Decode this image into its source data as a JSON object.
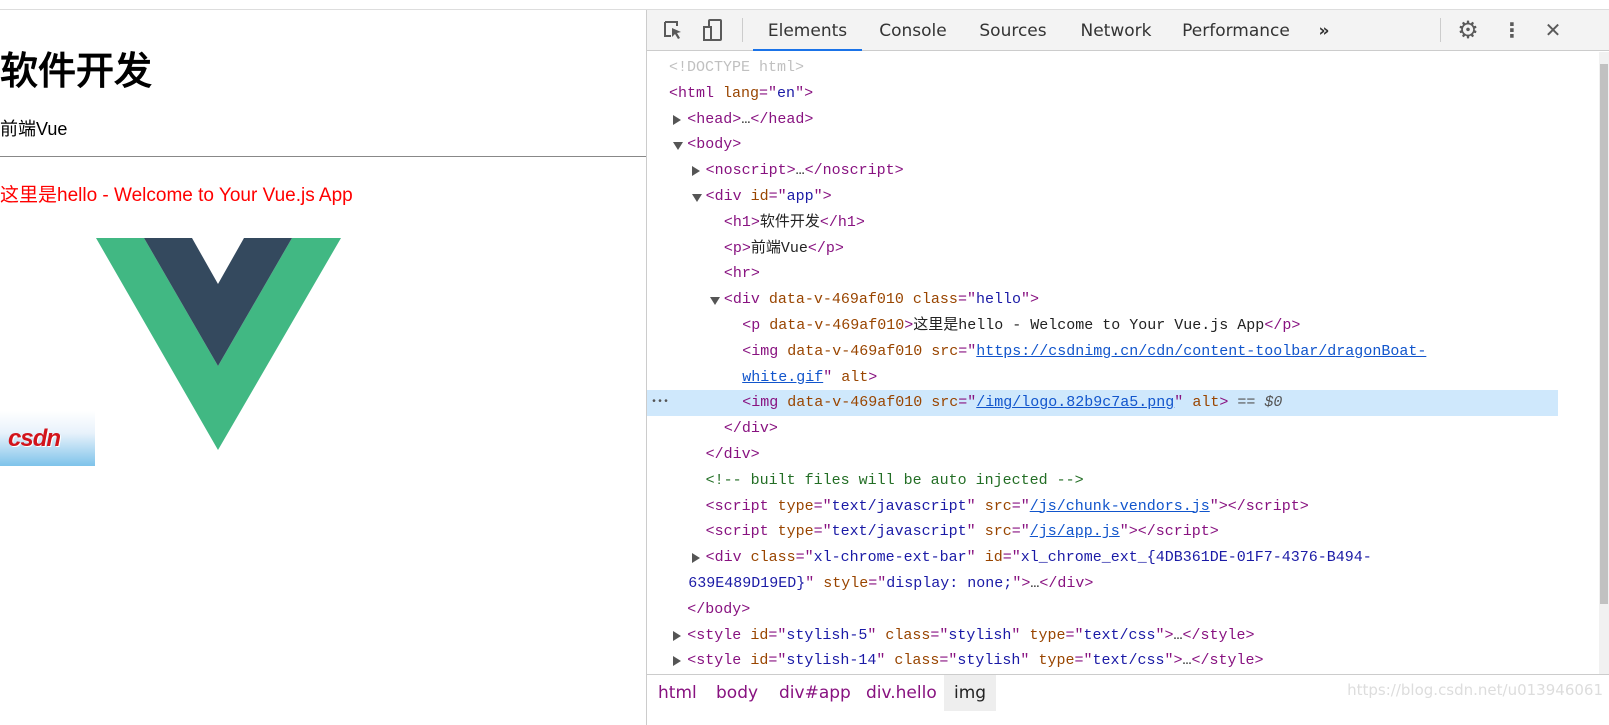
{
  "page": {
    "heading": "软件开发",
    "paragraph": "前端Vue",
    "hello_text": "这里是hello - Welcome to Your Vue.js App",
    "csdn_logo_text": "CSDN"
  },
  "devtools": {
    "tabs": [
      {
        "label": "Elements",
        "active": true
      },
      {
        "label": "Console"
      },
      {
        "label": "Sources"
      },
      {
        "label": "Network"
      },
      {
        "label": "Performance"
      }
    ],
    "more_tabs": "»",
    "settings_icon": "gear-icon",
    "menu_icon": "vertical-dots-icon",
    "close_icon": "close-icon",
    "selected_suffix": " == $0",
    "tree": [
      {
        "lvl": 0,
        "tok": [
          [
            "d",
            "<!DOCTYPE html>"
          ]
        ]
      },
      {
        "lvl": 0,
        "tok": [
          [
            "t",
            "<html "
          ],
          [
            "a",
            "lang"
          ],
          [
            "t",
            "=\""
          ],
          [
            "v",
            "en"
          ],
          [
            "t",
            "\">"
          ]
        ]
      },
      {
        "lvl": 1,
        "arrow": "r",
        "tok": [
          [
            "t",
            "<head>"
          ],
          [
            "x",
            "…"
          ],
          [
            "t",
            "</head>"
          ]
        ]
      },
      {
        "lvl": 1,
        "arrow": "d",
        "tok": [
          [
            "t",
            "<body>"
          ]
        ]
      },
      {
        "lvl": 2,
        "arrow": "r",
        "tok": [
          [
            "t",
            "<noscript>"
          ],
          [
            "x",
            "…"
          ],
          [
            "t",
            "</noscript>"
          ]
        ]
      },
      {
        "lvl": 2,
        "arrow": "d",
        "tok": [
          [
            "t",
            "<div "
          ],
          [
            "a",
            "id"
          ],
          [
            "t",
            "=\""
          ],
          [
            "v",
            "app"
          ],
          [
            "t",
            "\">"
          ]
        ]
      },
      {
        "lvl": 3,
        "tok": [
          [
            "t",
            "<h1>"
          ],
          [
            "x",
            "软件开发"
          ],
          [
            "t",
            "</h1>"
          ]
        ]
      },
      {
        "lvl": 3,
        "tok": [
          [
            "t",
            "<p>"
          ],
          [
            "x",
            "前端Vue"
          ],
          [
            "t",
            "</p>"
          ]
        ]
      },
      {
        "lvl": 3,
        "tok": [
          [
            "t",
            "<hr>"
          ]
        ]
      },
      {
        "lvl": 3,
        "arrow": "d",
        "tok": [
          [
            "t",
            "<div "
          ],
          [
            "a",
            "data-v-469af010 class"
          ],
          [
            "t",
            "=\""
          ],
          [
            "v",
            "hello"
          ],
          [
            "t",
            "\">"
          ]
        ]
      },
      {
        "lvl": 4,
        "tok": [
          [
            "t",
            "<p "
          ],
          [
            "a",
            "data-v-469af010"
          ],
          [
            "t",
            ">"
          ],
          [
            "x",
            "这里是hello - Welcome to Your Vue.js App"
          ],
          [
            "t",
            "</p>"
          ]
        ]
      },
      {
        "lvl": 4,
        "tok": [
          [
            "t",
            "<img "
          ],
          [
            "a",
            "data-v-469af010 src"
          ],
          [
            "t",
            "=\""
          ],
          [
            "l",
            "https://csdnimg.cn/cdn/content-toolbar/dragonBoat-"
          ]
        ]
      },
      {
        "lvl": 4,
        "tok": [
          [
            "l",
            "white.gif"
          ],
          [
            "t",
            "\" "
          ],
          [
            "a",
            "alt"
          ],
          [
            "t",
            ">"
          ]
        ]
      },
      {
        "lvl": 4,
        "sel": true,
        "tok": [
          [
            "t",
            "<img "
          ],
          [
            "a",
            "data-v-469af010 src"
          ],
          [
            "t",
            "=\""
          ],
          [
            "l",
            "/img/logo.82b9c7a5.png"
          ],
          [
            "t",
            "\" "
          ],
          [
            "a",
            "alt"
          ],
          [
            "t",
            ">"
          ],
          [
            "i",
            " == $0"
          ]
        ]
      },
      {
        "lvl": 3,
        "tok": [
          [
            "t",
            "</div>"
          ]
        ]
      },
      {
        "lvl": 2,
        "tok": [
          [
            "t",
            "</div>"
          ]
        ]
      },
      {
        "lvl": 2,
        "tok": [
          [
            "c",
            "<!-- built files will be auto injected -->"
          ]
        ]
      },
      {
        "lvl": 2,
        "tok": [
          [
            "t",
            "<script "
          ],
          [
            "a",
            "type"
          ],
          [
            "t",
            "=\""
          ],
          [
            "v",
            "text/javascript"
          ],
          [
            "t",
            "\" "
          ],
          [
            "a",
            "src"
          ],
          [
            "t",
            "=\""
          ],
          [
            "l",
            "/js/chunk-vendors.js"
          ],
          [
            "t",
            "\"></script>"
          ]
        ]
      },
      {
        "lvl": 2,
        "tok": [
          [
            "t",
            "<script "
          ],
          [
            "a",
            "type"
          ],
          [
            "t",
            "=\""
          ],
          [
            "v",
            "text/javascript"
          ],
          [
            "t",
            "\" "
          ],
          [
            "a",
            "src"
          ],
          [
            "t",
            "=\""
          ],
          [
            "l",
            "/js/app.js"
          ],
          [
            "t",
            "\"></script>"
          ]
        ]
      },
      {
        "lvl": 2,
        "arrow": "r",
        "tok": [
          [
            "t",
            "<div "
          ],
          [
            "a",
            "class"
          ],
          [
            "t",
            "=\""
          ],
          [
            "v",
            "xl-chrome-ext-bar"
          ],
          [
            "t",
            "\" "
          ],
          [
            "a",
            "id"
          ],
          [
            "t",
            "=\""
          ],
          [
            "v",
            "xl_chrome_ext_{4DB361DE-01F7-4376-B494-"
          ]
        ]
      },
      {
        "lvl": 1.05,
        "tok": [
          [
            "v",
            "639E489D19ED}"
          ],
          [
            "t",
            "\" "
          ],
          [
            "a",
            "style"
          ],
          [
            "t",
            "=\""
          ],
          [
            "v",
            "display: none;"
          ],
          [
            "t",
            "\">"
          ],
          [
            "x",
            "…"
          ],
          [
            "t",
            "</div>"
          ]
        ]
      },
      {
        "lvl": 1,
        "tok": [
          [
            "t",
            "</body>"
          ]
        ]
      },
      {
        "lvl": 1,
        "arrow": "r",
        "tok": [
          [
            "t",
            "<style "
          ],
          [
            "a",
            "id"
          ],
          [
            "t",
            "=\""
          ],
          [
            "v",
            "stylish-5"
          ],
          [
            "t",
            "\" "
          ],
          [
            "a",
            "class"
          ],
          [
            "t",
            "=\""
          ],
          [
            "v",
            "stylish"
          ],
          [
            "t",
            "\" "
          ],
          [
            "a",
            "type"
          ],
          [
            "t",
            "=\""
          ],
          [
            "v",
            "text/css"
          ],
          [
            "t",
            "\">"
          ],
          [
            "x",
            "…"
          ],
          [
            "t",
            "</style>"
          ]
        ]
      },
      {
        "lvl": 1,
        "arrow": "r",
        "tok": [
          [
            "t",
            "<style "
          ],
          [
            "a",
            "id"
          ],
          [
            "t",
            "=\""
          ],
          [
            "v",
            "stylish-14"
          ],
          [
            "t",
            "\" "
          ],
          [
            "a",
            "class"
          ],
          [
            "t",
            "=\""
          ],
          [
            "v",
            "stylish"
          ],
          [
            "t",
            "\" "
          ],
          [
            "a",
            "type"
          ],
          [
            "t",
            "=\""
          ],
          [
            "v",
            "text/css"
          ],
          [
            "t",
            "\">"
          ],
          [
            "x",
            "…"
          ],
          [
            "t",
            "</style>"
          ]
        ]
      }
    ],
    "breadcrumbs": [
      "html",
      "body",
      "div#app",
      "div.hello",
      "img"
    ],
    "watermark": "https://blog.csdn.net/u013946061"
  }
}
